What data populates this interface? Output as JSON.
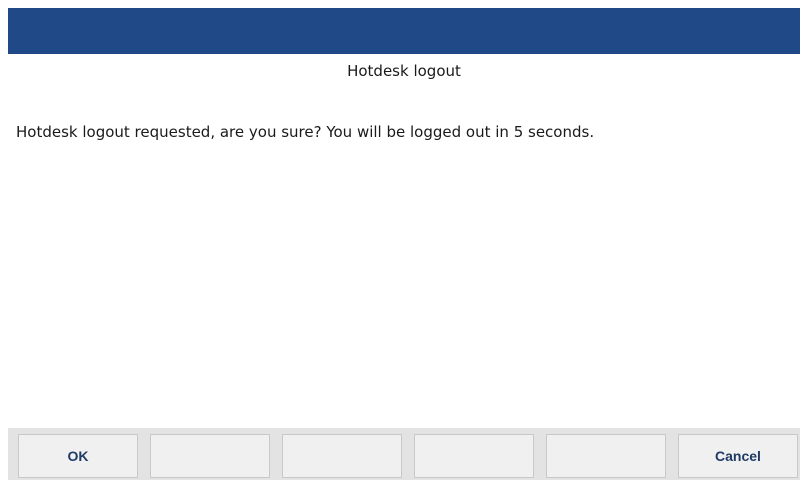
{
  "dialog": {
    "title": "Hotdesk logout",
    "message": "Hotdesk logout requested, are you sure? You will be logged out in 5 seconds."
  },
  "softkeys": [
    {
      "label": "OK"
    },
    {
      "label": ""
    },
    {
      "label": ""
    },
    {
      "label": ""
    },
    {
      "label": ""
    },
    {
      "label": "Cancel"
    }
  ],
  "colors": {
    "header_bar": "#1f4a87",
    "softkey_text": "#1f3a66"
  }
}
